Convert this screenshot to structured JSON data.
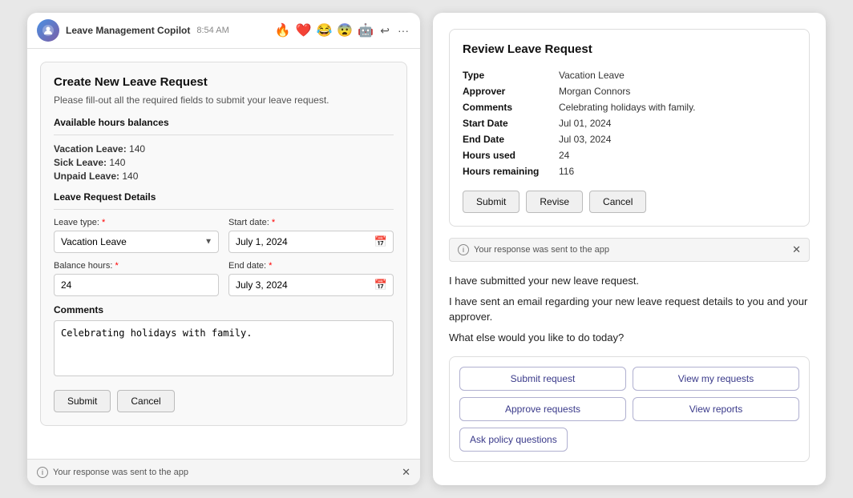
{
  "left": {
    "header": {
      "title": "Leave Management Copilot",
      "time": "8:54 AM",
      "emojis": [
        "🔥",
        "❤️",
        "😂",
        "😨",
        "🤖"
      ]
    },
    "form": {
      "title": "Create New Leave Request",
      "subtitle": "Please fill-out all the required fields to submit your leave request.",
      "balances_label": "Available hours balances",
      "balances": [
        {
          "label": "Vacation Leave",
          "value": "140"
        },
        {
          "label": "Sick Leave",
          "value": "140"
        },
        {
          "label": "Unpaid Leave",
          "value": "140"
        }
      ],
      "details_label": "Leave Request Details",
      "leave_type_label": "Leave type:",
      "leave_type_value": "Vacation Leave",
      "start_date_label": "Start date:",
      "start_date_value": "July 1, 2024",
      "balance_hours_label": "Balance hours:",
      "balance_hours_value": "24",
      "end_date_label": "End date:",
      "end_date_value": "July 3, 2024",
      "comments_label": "Comments",
      "comments_value": "Celebrating holidays with family.",
      "submit_label": "Submit",
      "cancel_label": "Cancel"
    },
    "notification": "Your response was sent to the app"
  },
  "right": {
    "review": {
      "title": "Review Leave Request",
      "fields": [
        {
          "label": "Type",
          "value": "Vacation Leave"
        },
        {
          "label": "Approver",
          "value": "Morgan Connors"
        },
        {
          "label": "Comments",
          "value": "Celebrating holidays with family."
        },
        {
          "label": "Start Date",
          "value": "Jul 01, 2024"
        },
        {
          "label": "End Date",
          "value": "Jul 03, 2024"
        },
        {
          "label": "Hours used",
          "value": "24"
        },
        {
          "label": "Hours remaining",
          "value": "116"
        }
      ],
      "submit_label": "Submit",
      "revise_label": "Revise",
      "cancel_label": "Cancel"
    },
    "sent_notification": "Your response was sent to the app",
    "messages": [
      "I have submitted your new leave request.",
      "I have sent an email regarding your new leave request details to you and your approver.",
      "What else would you like to do today?"
    ],
    "quick_actions": [
      {
        "label": "Submit request",
        "full": false
      },
      {
        "label": "View my requests",
        "full": false
      },
      {
        "label": "Approve requests",
        "full": false
      },
      {
        "label": "View reports",
        "full": false
      },
      {
        "label": "Ask policy questions",
        "full": true
      }
    ]
  }
}
